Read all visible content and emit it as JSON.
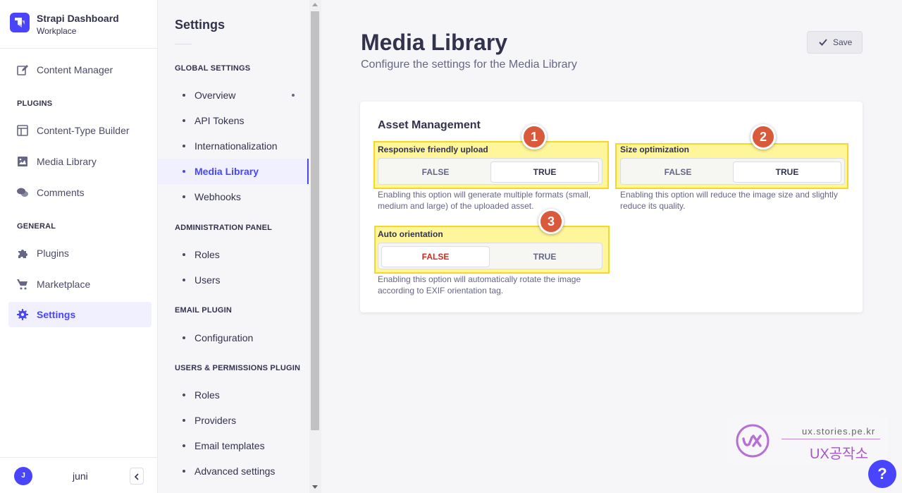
{
  "brand": {
    "title": "Strapi Dashboard",
    "subtitle": "Workplace",
    "accent": "#4945ff"
  },
  "nav": {
    "content_manager": "Content Manager",
    "plugins_section": "PLUGINS",
    "content_type_builder": "Content-Type Builder",
    "media_library": "Media Library",
    "comments": "Comments",
    "general_section": "GENERAL",
    "plugins": "Plugins",
    "marketplace": "Marketplace",
    "settings": "Settings",
    "active": "Settings"
  },
  "user": {
    "initial": "J",
    "name": "juni"
  },
  "settings_nav": {
    "title": "Settings",
    "global_section": "GLOBAL SETTINGS",
    "overview": "Overview",
    "api_tokens": "API Tokens",
    "internationalization": "Internationalization",
    "media_library": "Media Library",
    "webhooks": "Webhooks",
    "admin_section": "ADMINISTRATION PANEL",
    "admin_roles": "Roles",
    "admin_users": "Users",
    "email_section": "EMAIL PLUGIN",
    "configuration": "Configuration",
    "up_section": "USERS & PERMISSIONS PLUGIN",
    "up_roles": "Roles",
    "providers": "Providers",
    "email_templates": "Email templates",
    "advanced_settings": "Advanced settings",
    "active": "Media Library"
  },
  "page": {
    "title": "Media Library",
    "subtitle": "Configure the settings for the Media Library",
    "save_label": "Save"
  },
  "asset_management": {
    "title": "Asset Management",
    "responsive": {
      "label": "Responsive friendly upload",
      "false_label": "FALSE",
      "true_label": "TRUE",
      "value": true,
      "hint": "Enabling this option will generate multiple formats (small, medium and large) of the uploaded asset."
    },
    "size_optimization": {
      "label": "Size optimization",
      "false_label": "FALSE",
      "true_label": "TRUE",
      "value": true,
      "hint": "Enabling this option will reduce the image size and slightly reduce its quality."
    },
    "auto_orientation": {
      "label": "Auto orientation",
      "false_label": "FALSE",
      "true_label": "TRUE",
      "value": false,
      "hint": "Enabling this option will automatically rotate the image according to EXIF orientation tag."
    }
  },
  "annotations": {
    "marker_1": "1",
    "marker_2": "2",
    "marker_3": "3",
    "marker_color": "#d9593a",
    "highlight_color": "#fff59a"
  },
  "watermark": {
    "url": "ux.stories.pe.kr",
    "name": "UX공작소"
  },
  "help": {
    "label": "?"
  }
}
